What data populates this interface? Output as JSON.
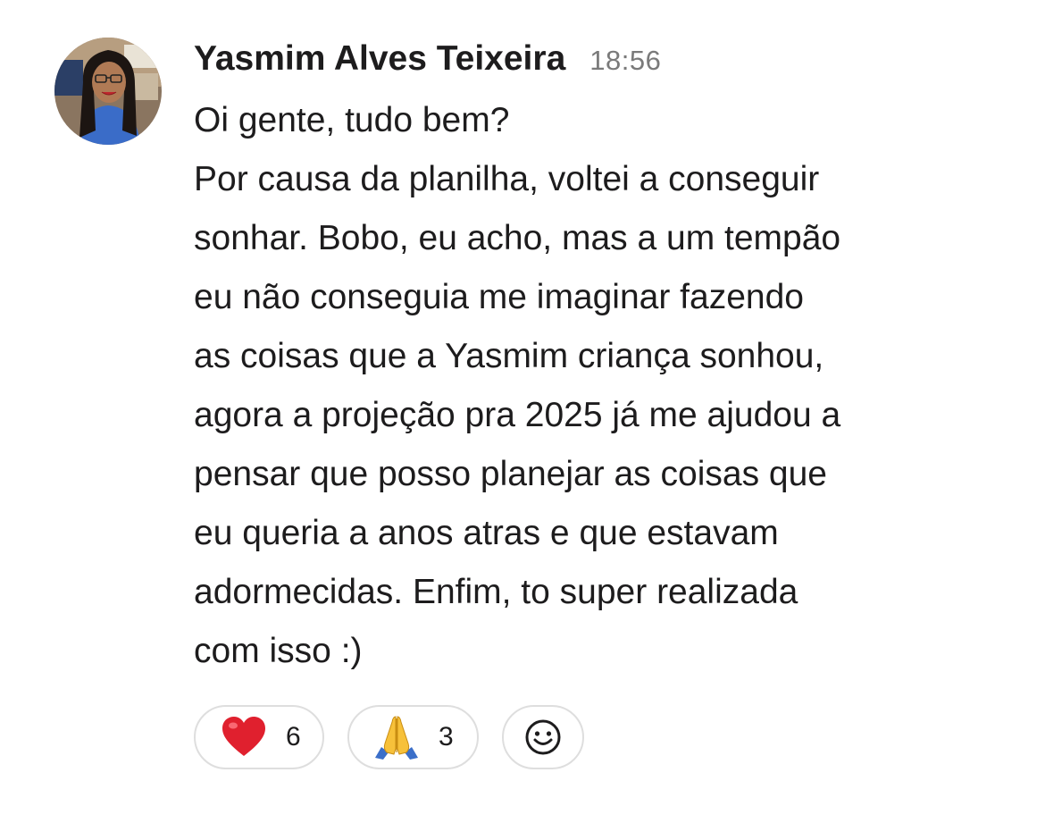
{
  "message": {
    "author": "Yasmim Alves Teixeira",
    "timestamp": "18:56",
    "lines": [
      "Oi gente, tudo bem?",
      "Por causa da planilha, voltei a conseguir",
      "sonhar. Bobo, eu acho, mas a um tempão",
      "eu não conseguia me imaginar fazendo",
      "as coisas que a Yasmim criança sonhou,",
      "agora a projeção pra 2025 já me ajudou a",
      "pensar que posso planejar as coisas que",
      "eu queria a anos atras e que estavam",
      "adormecidas. Enfim, to super realizada",
      "com isso :)"
    ]
  },
  "reactions": [
    {
      "emoji": "heart-emoji",
      "count": "6"
    },
    {
      "emoji": "folded-hands-emoji",
      "count": "3"
    }
  ],
  "add_reaction": {
    "icon": "smiley-add-reaction-icon"
  },
  "colors": {
    "text": "#1d1c1d",
    "timestamp": "#7a7a7a",
    "pill_border": "#dedede",
    "heart": "#e0202e",
    "background": "#ffffff"
  }
}
